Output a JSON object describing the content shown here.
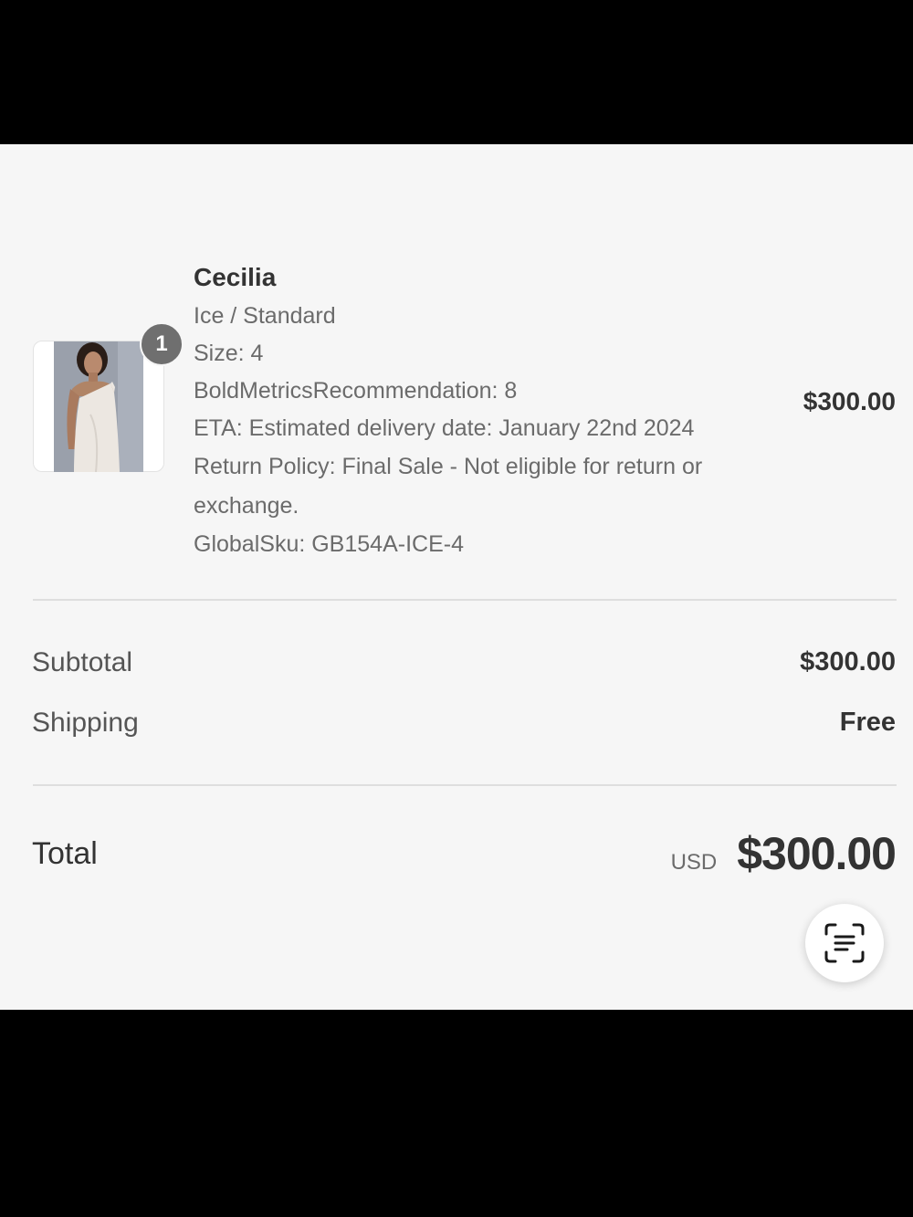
{
  "item": {
    "quantity": "1",
    "name": "Cecilia",
    "variant": "Ice / Standard",
    "size": "Size: 4",
    "recommendation": "BoldMetricsRecommendation: 8",
    "eta": "ETA: Estimated delivery date: January 22nd 2024",
    "return_policy": "Return Policy: Final Sale - Not eligible for return or exchange.",
    "global_sku": "GlobalSku: GB154A-ICE-4",
    "price": "$300.00",
    "image_icon": "product-photo"
  },
  "summary": {
    "subtotal_label": "Subtotal",
    "subtotal_value": "$300.00",
    "shipping_label": "Shipping",
    "shipping_value": "Free",
    "total_label": "Total",
    "currency": "USD",
    "total_value": "$300.00"
  },
  "scan_button": {
    "icon": "scan-text-icon"
  },
  "colors": {
    "panel_bg": "#f6f6f6",
    "badge_bg": "#6f6f6f",
    "text_primary": "#333333",
    "text_secondary": "#6b6b6b"
  }
}
